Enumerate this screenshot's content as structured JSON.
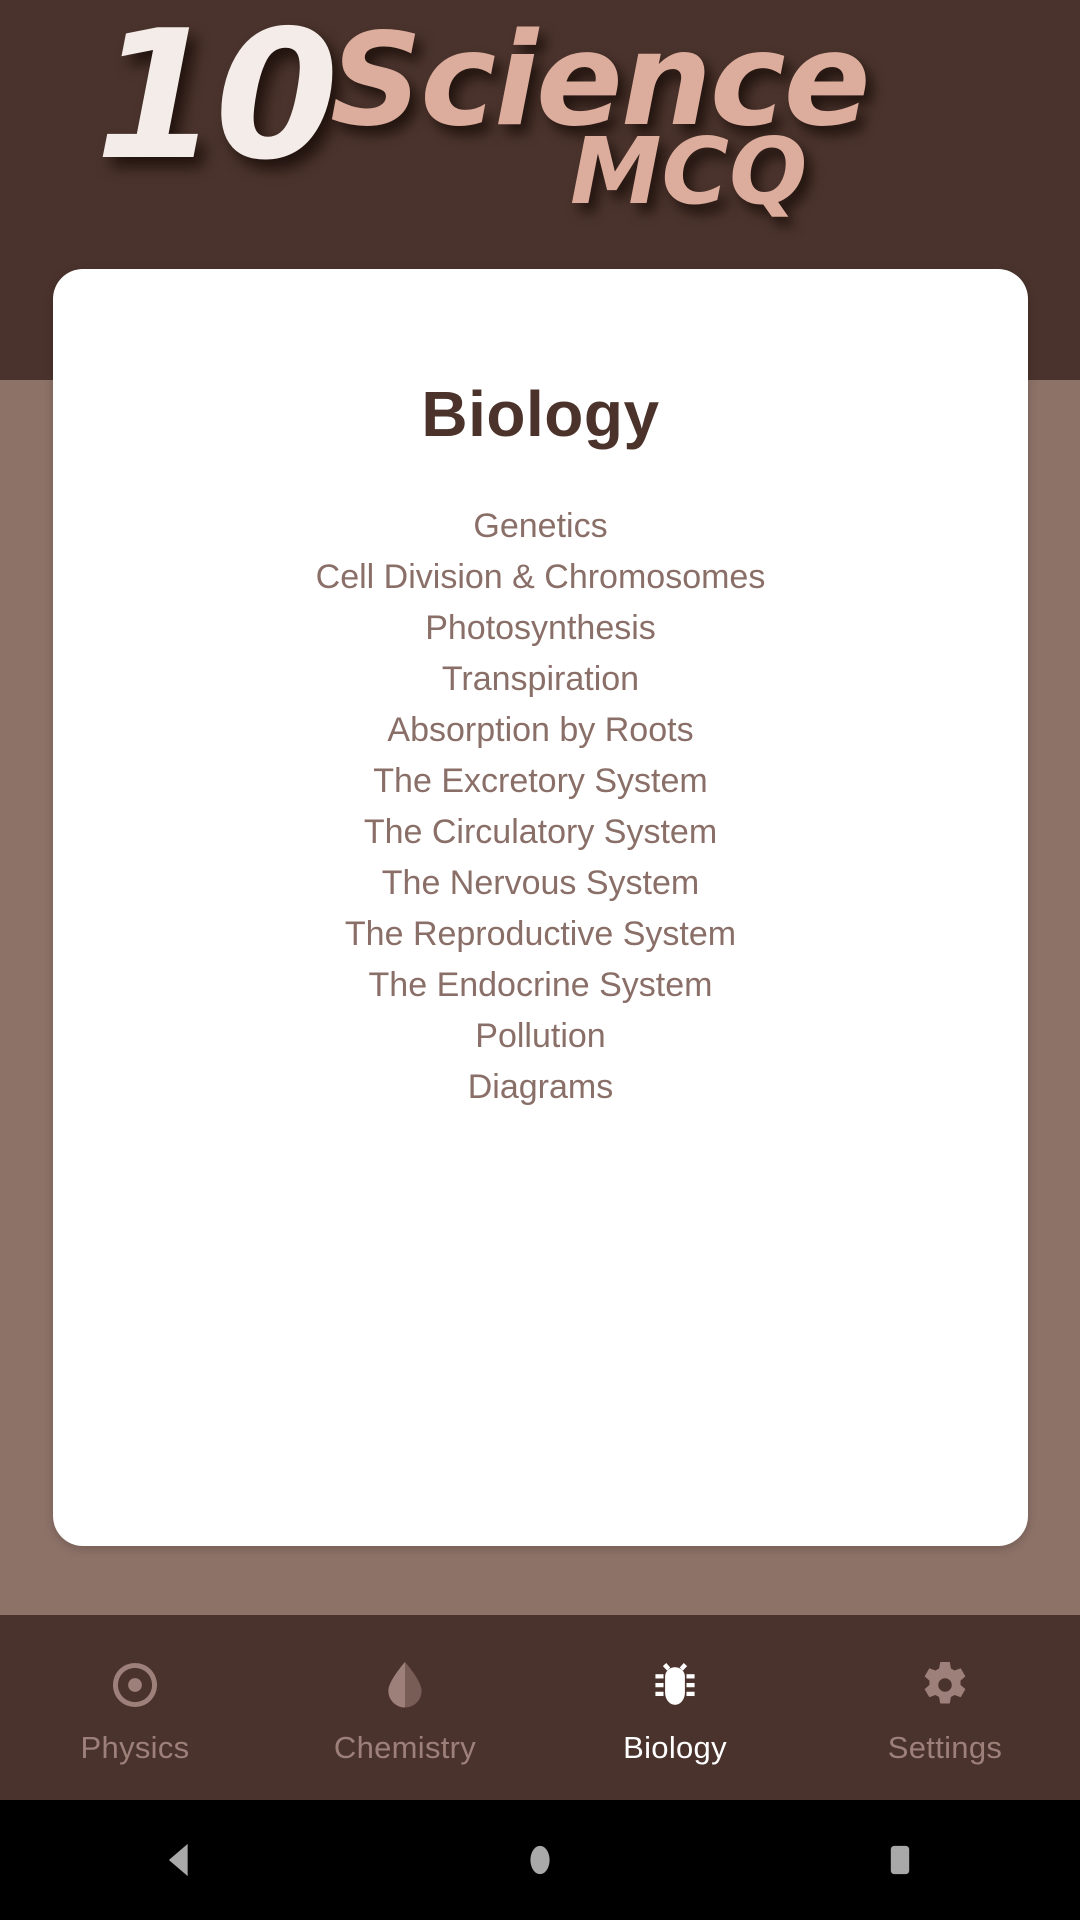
{
  "app": {
    "logo": {
      "number": "10",
      "word": "Science",
      "subword": "MCQ",
      "number_color": "#f3ece8",
      "word_color": "#dcac9c",
      "banner_color": "#4a332c"
    },
    "page_background": "#8d7268"
  },
  "card": {
    "title": "Biology",
    "title_color": "#4b332b",
    "background": "#ffffff",
    "topic_color": "#8a6f68",
    "topics": [
      {
        "label": "Genetics"
      },
      {
        "label": "Cell Division & Chromosomes"
      },
      {
        "label": "Photosynthesis"
      },
      {
        "label": "Transpiration"
      },
      {
        "label": "Absorption by Roots"
      },
      {
        "label": "The Excretory System"
      },
      {
        "label": "The Circulatory System"
      },
      {
        "label": "The Nervous System"
      },
      {
        "label": "The Reproductive System"
      },
      {
        "label": "The Endocrine System"
      },
      {
        "label": "Pollution"
      },
      {
        "label": "Diagrams"
      }
    ]
  },
  "tabbar": {
    "background": "#4a332c",
    "active_color": "#ffffff",
    "inactive_color": "#9d8079",
    "tabs": [
      {
        "label": "Physics",
        "icon": "atom-icon",
        "active": false
      },
      {
        "label": "Chemistry",
        "icon": "droplet-icon",
        "active": false
      },
      {
        "label": "Biology",
        "icon": "bug-icon",
        "active": true
      },
      {
        "label": "Settings",
        "icon": "gear-icon",
        "active": false
      }
    ]
  },
  "system_nav": {
    "background": "#000000",
    "glyph_color": "#a9a9a9",
    "buttons": [
      {
        "name": "back-button",
        "icon": "triangle-left-icon"
      },
      {
        "name": "home-button",
        "icon": "circle-icon"
      },
      {
        "name": "recents-button",
        "icon": "square-icon"
      }
    ]
  }
}
